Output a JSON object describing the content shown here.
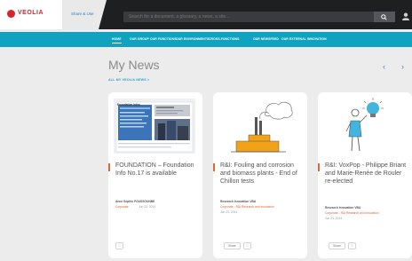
{
  "brand": {
    "logo_text": "VEOLIA",
    "accent": "#d8232a",
    "nav_color": "#10a3bf"
  },
  "header": {
    "tab_label": "Share & Use",
    "search_placeholder": "Search for a document, a glossary, a news, a site..."
  },
  "nav": [
    "HOME",
    "OUR GROUP",
    "OUR FUNCTIONS",
    "OUR ENVIRONMENTS",
    "CROSS-FUNCTIONS",
    "OUR NEWSFEED",
    "OUR EXTERNAL INNOVATION"
  ],
  "main": {
    "title": "My News",
    "all_link": "ALL MY VEOLIA NEWS  >"
  },
  "cards": [
    {
      "title": "FOUNDATION – Foundation Info No.17 is available",
      "author": "Anne Sophie FOUSSOUNBE",
      "tag": "Corporate",
      "date": "Jun 23, 2014",
      "btn_share": "",
      "thumb_heading": "Foundation Infos"
    },
    {
      "title": "R&I: Fouling and corrosion and biomass plants - End of Chillon tests",
      "author": "Research Innovation VBA",
      "tag": "Corporate - R&I Research and Innovation",
      "date": "Jun 23, 2014",
      "btn_share": "Share"
    },
    {
      "title": "R&I: VoxPop - Philippe Briant and Marie-Renée de Rouler re-elected",
      "author": "Research Innovation VBA",
      "tag": "Corporate - R&I Research and Innovation",
      "date": "Jun 23, 2014",
      "btn_share": "Share"
    }
  ]
}
